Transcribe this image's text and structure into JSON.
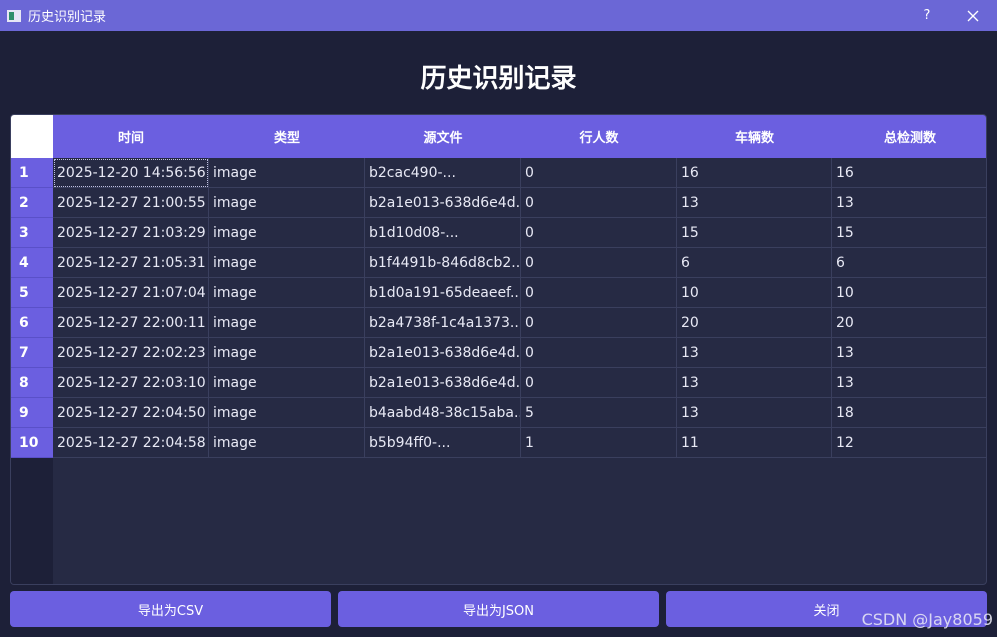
{
  "window": {
    "title": "历史识别记录",
    "help_label": "?"
  },
  "heading": "历史识别记录",
  "table": {
    "columns": [
      "时间",
      "类型",
      "源文件",
      "行人数",
      "车辆数",
      "总检测数"
    ],
    "rows": [
      {
        "num": "1",
        "cells": [
          "2025-12-20 14:56:56",
          "image",
          "b2cac490-...",
          "0",
          "16",
          "16"
        ]
      },
      {
        "num": "2",
        "cells": [
          "2025-12-27 21:00:55",
          "image",
          "b2a1e013-638d6e4d...",
          "0",
          "13",
          "13"
        ]
      },
      {
        "num": "3",
        "cells": [
          "2025-12-27 21:03:29",
          "image",
          "b1d10d08-...",
          "0",
          "15",
          "15"
        ]
      },
      {
        "num": "4",
        "cells": [
          "2025-12-27 21:05:31",
          "image",
          "b1f4491b-846d8cb2....",
          "0",
          "6",
          "6"
        ]
      },
      {
        "num": "5",
        "cells": [
          "2025-12-27 21:07:04",
          "image",
          "b1d0a191-65deaeef....",
          "0",
          "10",
          "10"
        ]
      },
      {
        "num": "6",
        "cells": [
          "2025-12-27 22:00:11",
          "image",
          "b2a4738f-1c4a1373....",
          "0",
          "20",
          "20"
        ]
      },
      {
        "num": "7",
        "cells": [
          "2025-12-27 22:02:23",
          "image",
          "b2a1e013-638d6e4d...",
          "0",
          "13",
          "13"
        ]
      },
      {
        "num": "8",
        "cells": [
          "2025-12-27 22:03:10",
          "image",
          "b2a1e013-638d6e4d...",
          "0",
          "13",
          "13"
        ]
      },
      {
        "num": "9",
        "cells": [
          "2025-12-27 22:04:50",
          "image",
          "b4aabd48-38c15aba...",
          "5",
          "13",
          "18"
        ]
      },
      {
        "num": "10",
        "cells": [
          "2025-12-27 22:04:58",
          "image",
          "b5b94ff0-...",
          "1",
          "11",
          "12"
        ]
      }
    ]
  },
  "buttons": {
    "export_csv": "导出为CSV",
    "export_json": "导出为JSON",
    "close": "关闭"
  },
  "watermark": "CSDN @Jay8059",
  "colors": {
    "accent": "#6b5fe0",
    "titlebar": "#6b67d6",
    "background": "#1d2038",
    "table_bg": "#262a44"
  }
}
